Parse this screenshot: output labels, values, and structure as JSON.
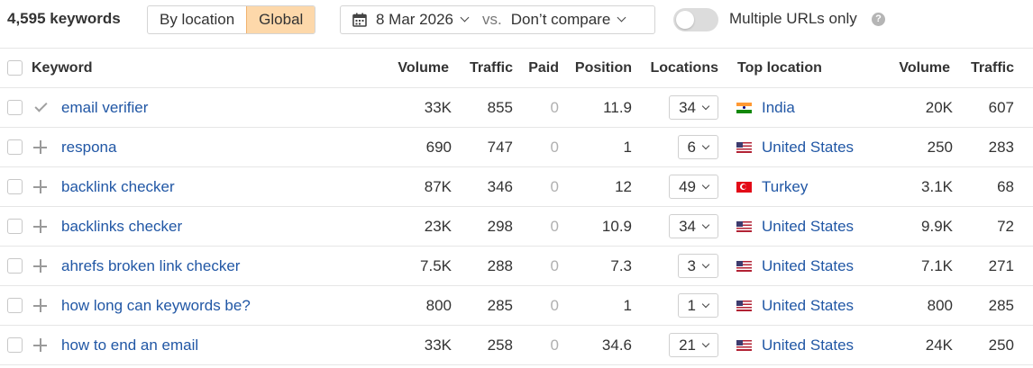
{
  "toolbar": {
    "count": "4,595 keywords",
    "scope_options": [
      "By location",
      "Global"
    ],
    "scope_selected": "Global",
    "date": "8 Mar 2026",
    "vs": "vs.",
    "compare": "Don’t compare",
    "toggle_label": "Multiple URLs only",
    "toggle_on": false,
    "help": "?"
  },
  "columns": [
    "Keyword",
    "Volume",
    "Traffic",
    "Paid",
    "Position",
    "Locations",
    "Top location",
    "Volume",
    "Traffic"
  ],
  "rows": [
    {
      "icon": "check",
      "keyword": "email verifier",
      "volume": "33K",
      "traffic": "855",
      "paid": "0",
      "position": "11.9",
      "locations": "34",
      "flag": "in",
      "top_location": "India",
      "loc_volume": "20K",
      "loc_traffic": "607"
    },
    {
      "icon": "plus",
      "keyword": "respona",
      "volume": "690",
      "traffic": "747",
      "paid": "0",
      "position": "1",
      "locations": "6",
      "flag": "us",
      "top_location": "United States",
      "loc_volume": "250",
      "loc_traffic": "283"
    },
    {
      "icon": "plus",
      "keyword": "backlink checker",
      "volume": "87K",
      "traffic": "346",
      "paid": "0",
      "position": "12",
      "locations": "49",
      "flag": "tr",
      "top_location": "Turkey",
      "loc_volume": "3.1K",
      "loc_traffic": "68"
    },
    {
      "icon": "plus",
      "keyword": "backlinks checker",
      "volume": "23K",
      "traffic": "298",
      "paid": "0",
      "position": "10.9",
      "locations": "34",
      "flag": "us",
      "top_location": "United States",
      "loc_volume": "9.9K",
      "loc_traffic": "72"
    },
    {
      "icon": "plus",
      "keyword": "ahrefs broken link checker",
      "volume": "7.5K",
      "traffic": "288",
      "paid": "0",
      "position": "7.3",
      "locations": "3",
      "flag": "us",
      "top_location": "United States",
      "loc_volume": "7.1K",
      "loc_traffic": "271"
    },
    {
      "icon": "plus",
      "keyword": "how long can keywords be?",
      "volume": "800",
      "traffic": "285",
      "paid": "0",
      "position": "1",
      "locations": "1",
      "flag": "us",
      "top_location": "United States",
      "loc_volume": "800",
      "loc_traffic": "285"
    },
    {
      "icon": "plus",
      "keyword": "how to end an email",
      "volume": "33K",
      "traffic": "258",
      "paid": "0",
      "position": "34.6",
      "locations": "21",
      "flag": "us",
      "top_location": "United States",
      "loc_volume": "24K",
      "loc_traffic": "250"
    }
  ],
  "colors": {
    "link": "#2157a5",
    "active_segment": "#fdd8aa",
    "toggle_off": "#dcdcdc"
  }
}
